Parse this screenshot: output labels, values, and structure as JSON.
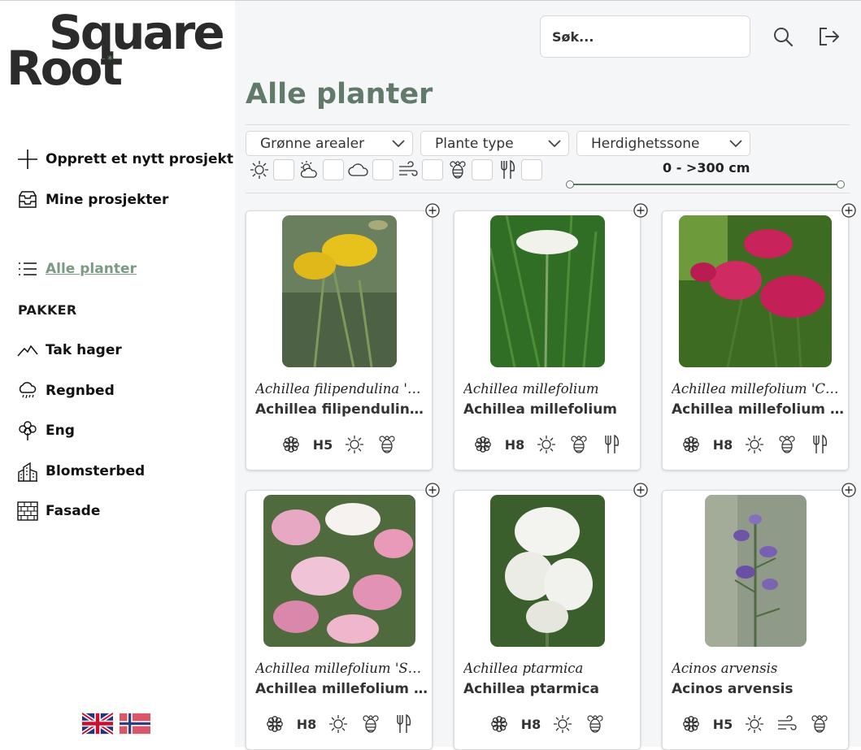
{
  "brand": {
    "line1": "Square",
    "line2": "Root",
    "spark": "*"
  },
  "sidebar": {
    "new_project": "Opprett et nytt prosjekt",
    "my_projects": "Mine prosjekter",
    "all_plants": "Alle planter",
    "packages_heading": "PAKKER",
    "packages": [
      "Tak hager",
      "Regnbed",
      "Eng",
      "Blomsterbed",
      "Fasade"
    ],
    "languages": [
      "English",
      "Norsk"
    ]
  },
  "header": {
    "search_placeholder": "Søk..."
  },
  "page": {
    "title": "Alle planter"
  },
  "filters": {
    "dropdowns": [
      "Grønne arealer",
      "Plante type",
      "Herdighetssone"
    ],
    "toggles": [
      "sun-icon",
      "partial-sun-icon",
      "cloud-icon",
      "wind-icon",
      "bee-icon",
      "edible-icon"
    ],
    "height_range": "0 - >300 cm",
    "height_slider": {
      "min": 0,
      "max": 1
    }
  },
  "plants": [
    {
      "latin": "Achillea filipendulina 'Parker'",
      "common": "Achillea filipendulina 'Parker'",
      "zone": "H5",
      "attrs": [
        "flower-icon",
        "zone",
        "sun-icon",
        "bee-icon"
      ]
    },
    {
      "latin": "Achillea millefolium",
      "common": "Achillea millefolium",
      "zone": "H8",
      "attrs": [
        "flower-icon",
        "zone",
        "sun-icon",
        "bee-icon",
        "edible-icon"
      ]
    },
    {
      "latin": "Achillea millefolium 'Cassis'",
      "common": "Achillea millefolium 'Cassis'",
      "zone": "H8",
      "attrs": [
        "flower-icon",
        "zone",
        "sun-icon",
        "bee-icon",
        "edible-icon"
      ]
    },
    {
      "latin": "Achillea millefolium 'Summer Berries'",
      "common": "Achillea millefolium 'Summer Berries'",
      "zone": "H8",
      "attrs": [
        "flower-icon",
        "zone",
        "sun-icon",
        "bee-icon",
        "edible-icon"
      ]
    },
    {
      "latin": "Achillea ptarmica",
      "common": "Achillea ptarmica",
      "zone": "H8",
      "attrs": [
        "flower-icon",
        "zone",
        "sun-icon",
        "bee-icon"
      ]
    },
    {
      "latin": "Acinos arvensis",
      "common": "Acinos arvensis",
      "zone": "H5",
      "attrs": [
        "flower-icon",
        "zone",
        "sun-icon",
        "wind-icon",
        "bee-icon"
      ]
    }
  ],
  "colors": {
    "accent": "#627a6a",
    "active_link": "#7a9b82",
    "slider": "#5a7563"
  }
}
